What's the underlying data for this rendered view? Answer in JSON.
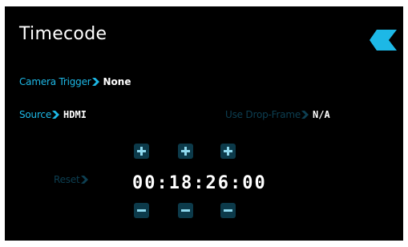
{
  "title": "Timecode",
  "icons": {
    "back": "back-chevron-icon",
    "arrow": "chevron-right-icon",
    "plus": "plus-icon",
    "minus": "minus-icon"
  },
  "colors": {
    "accent": "#1db8e6",
    "disabled": "#0d3f52",
    "button_bg": "#0c3a4a",
    "background": "#000000",
    "text": "#ffffff"
  },
  "camera_trigger": {
    "label": "Camera Trigger",
    "value": "None"
  },
  "source": {
    "label": "Source",
    "value": "HDMI"
  },
  "drop_frame": {
    "label": "Use Drop-Frame",
    "value": "N/A",
    "enabled": false
  },
  "reset": {
    "label": "Reset",
    "enabled": false
  },
  "timecode": {
    "value": "00:18:26:00",
    "hours": "00",
    "minutes": "18",
    "seconds": "26",
    "frames": "00"
  }
}
